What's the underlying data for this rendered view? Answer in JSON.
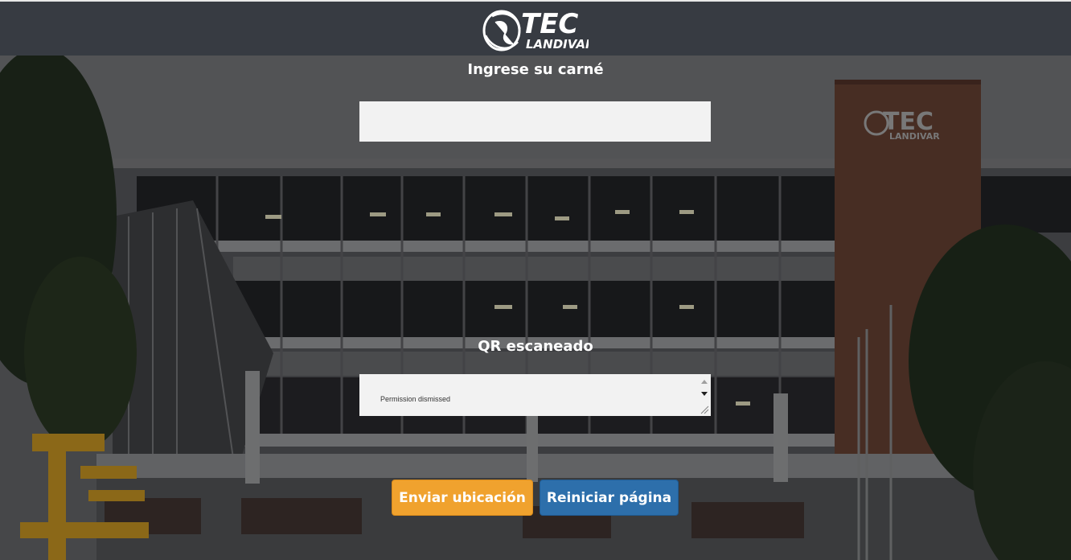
{
  "header": {
    "logo_text_top": "TEC",
    "logo_text_bottom": "LANDIVAR",
    "logo_icon": "globe-icon"
  },
  "background": {
    "building_sign_top": "TEC",
    "building_sign_bottom": "LANDIVAR"
  },
  "form": {
    "carne_label": "Ingrese su carné",
    "carne_value": "",
    "qr_label": "QR escaneado",
    "qr_value": "Permission dismissed"
  },
  "buttons": {
    "send_location": "Enviar ubicación",
    "reload_page": "Reiniciar página"
  },
  "colors": {
    "header_bg": "#373b42",
    "orange": "#f0a22e",
    "blue": "#2d6fab",
    "input_bg": "#f2f2f2"
  }
}
